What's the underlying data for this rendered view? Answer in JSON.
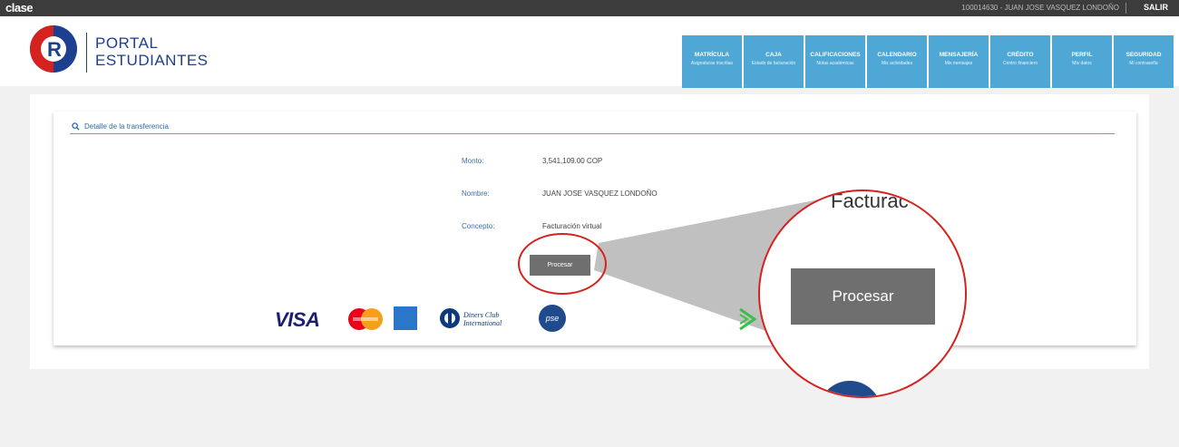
{
  "topbar": {
    "logo": "clase",
    "user": "100014630 - JUAN JOSE VASQUEZ LONDOÑO",
    "logout": "SALIR"
  },
  "brand": {
    "line1": "PORTAL",
    "line2": "ESTUDIANTES",
    "mark_letter": "R"
  },
  "nav": [
    {
      "title": "MATRÍCULA",
      "subtitle": "Asignaturas inscritas"
    },
    {
      "title": "CAJA",
      "subtitle": "Estado de facturación"
    },
    {
      "title": "CALIFICACIONES",
      "subtitle": "Notas académicas"
    },
    {
      "title": "CALENDARIO",
      "subtitle": "Mis actividades"
    },
    {
      "title": "MENSAJERÍA",
      "subtitle": "Mis mensajes"
    },
    {
      "title": "CRÉDITO",
      "subtitle": "Centro financiero"
    },
    {
      "title": "PERFIL",
      "subtitle": "Mis datos"
    },
    {
      "title": "SEGURIDAD",
      "subtitle": "Mi contraseña"
    }
  ],
  "detail": {
    "title": "Detalle de la transferencia",
    "monto_label": "Monto:",
    "monto_value": "3,541,109.00 COP",
    "nombre_label": "Nombre:",
    "nombre_value": "JUAN JOSE VASQUEZ LONDOÑO",
    "concepto_label": "Concepto:",
    "concepto_value": "Facturación virtual",
    "button": "Procesar"
  },
  "zoom": {
    "partial_text": "Facturac",
    "button": "Procesar"
  },
  "payments": {
    "visa": "VISA",
    "diners_line1": "Diners Club",
    "diners_line2": "International",
    "pse": "pse"
  },
  "colors": {
    "nav": "#4ea7d4",
    "brand_blue": "#1d3f8f",
    "highlight_red": "#d6221f",
    "button_gray": "#6f6f6f"
  }
}
